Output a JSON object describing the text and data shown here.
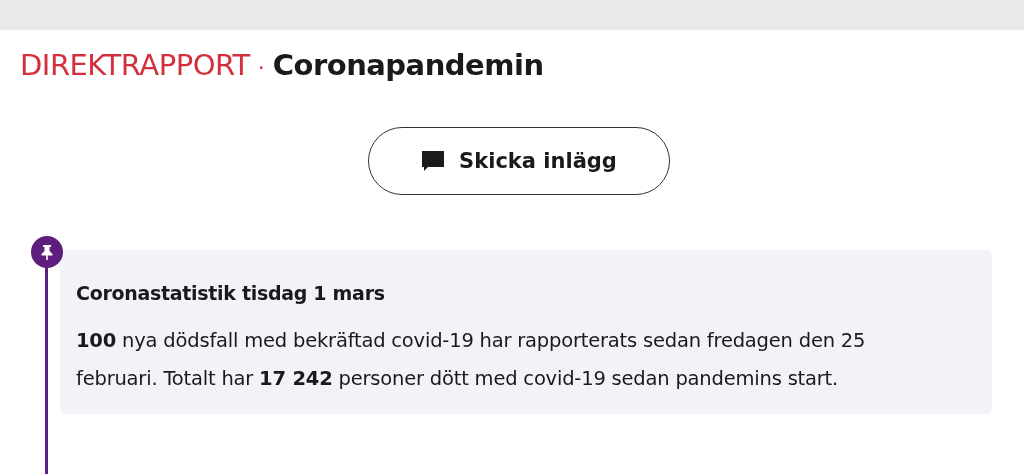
{
  "header": {
    "label": "DIREKTRAPPORT",
    "separator": "·",
    "title": "Coronapandemin"
  },
  "submit_button": {
    "label": "Skicka inlägg"
  },
  "posts": [
    {
      "pinned": true,
      "title": "Coronastatistik tisdag 1 mars",
      "body": "**100** nya dödsfall med bekräftad covid-19 har rapporterats sedan fredagen den 25 februari. Totalt har **17 242** personer dött med covid-19 sedan pandemins start."
    }
  ]
}
